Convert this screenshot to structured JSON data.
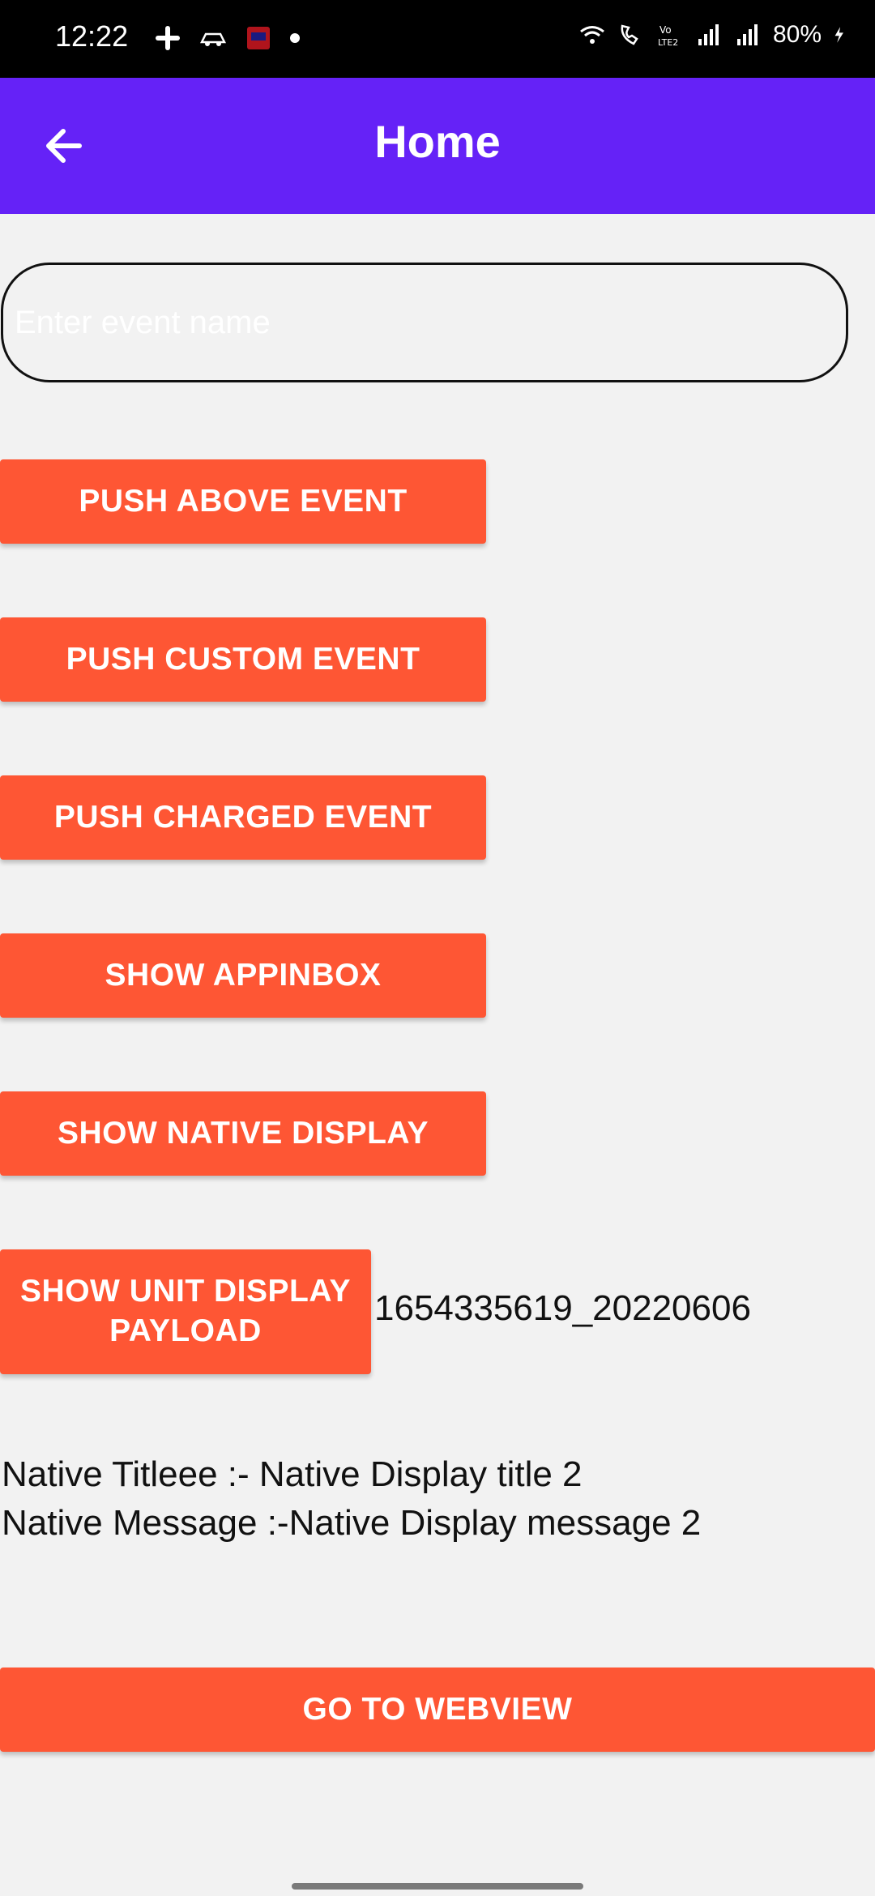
{
  "status_bar": {
    "time": "12:22",
    "battery": "80%"
  },
  "app_bar": {
    "title": "Home",
    "back_icon": "arrow-left-icon",
    "color": "#6522f7"
  },
  "event_input": {
    "placeholder": "Enter event name",
    "value": ""
  },
  "buttons": {
    "push_above_event": "PUSH ABOVE EVENT",
    "push_custom_event": "PUSH CUSTOM EVENT",
    "push_charged_event": "PUSH CHARGED EVENT",
    "show_appinbox": "SHOW APPINBOX",
    "show_native_display": "SHOW NATIVE DISPLAY",
    "show_unit_display_payload": "SHOW UNIT DISPLAY PAYLOAD",
    "go_to_webview": "GO TO WEBVIEW",
    "color": "#fe5634"
  },
  "unit_display_id": "1654335619_20220606",
  "native_display": {
    "title_line": "Native Titleee :- Native Display title 2",
    "message_line": "Native Message :-Native Display message 2"
  }
}
